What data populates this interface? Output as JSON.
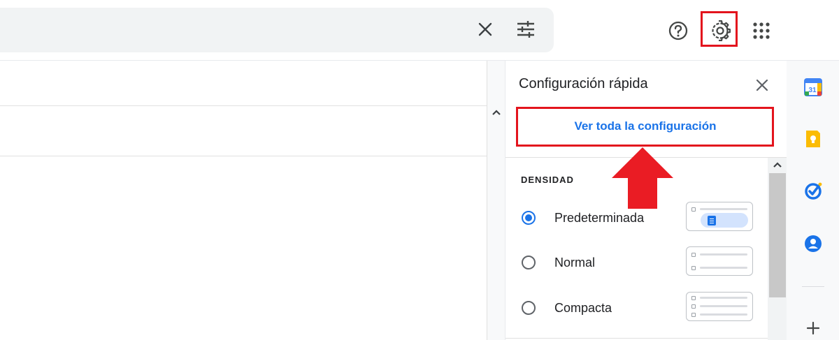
{
  "quick_settings": {
    "title": "Configuración rápida",
    "view_all_label": "Ver toda la configuración",
    "density_section_label": "DENSIDAD",
    "density_options": [
      {
        "label": "Predeterminada",
        "selected": true
      },
      {
        "label": "Normal",
        "selected": false
      },
      {
        "label": "Compacta",
        "selected": false
      }
    ]
  },
  "colors": {
    "accent_blue": "#1a73e8",
    "highlight_red": "#e3141d",
    "annotation_arrow": "#e3141d"
  },
  "icons": {
    "search_clear": "close-icon",
    "search_options": "tune-icon",
    "help": "help-icon",
    "settings": "gear-icon",
    "apps": "apps-grid-icon",
    "side_panel": [
      "calendar-icon",
      "keep-icon",
      "tasks-icon",
      "contacts-icon",
      "add-icon"
    ]
  },
  "side_panel": {
    "calendar_day": "31"
  }
}
